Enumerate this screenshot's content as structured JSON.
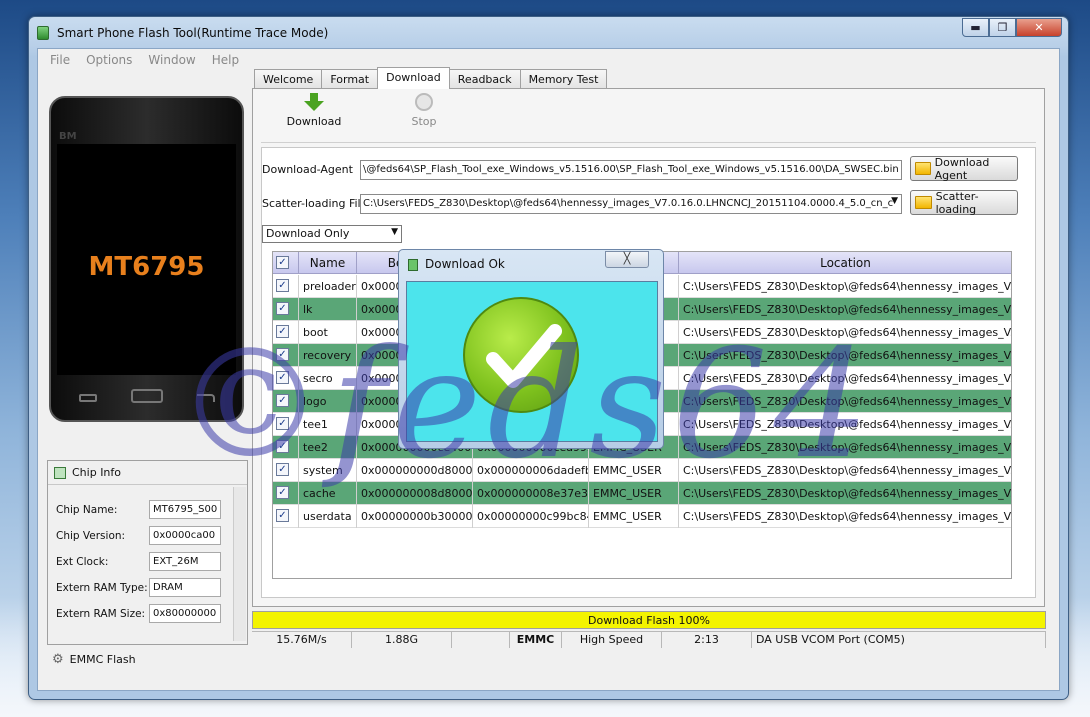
{
  "window": {
    "title": "Smart Phone Flash Tool(Runtime Trace Mode)",
    "min": "▬",
    "max": "❐",
    "close": "✕"
  },
  "menu": [
    "File",
    "Options",
    "Window",
    "Help"
  ],
  "phone": {
    "brand": "BM",
    "chip": "MT6795"
  },
  "chip_info": {
    "title": "Chip Info",
    "rows": [
      {
        "label": "Chip Name:",
        "value": "MT6795_S00"
      },
      {
        "label": "Chip Version:",
        "value": "0x0000ca00"
      },
      {
        "label": "Ext Clock:",
        "value": "EXT_26M"
      },
      {
        "label": "Extern RAM Type:",
        "value": "DRAM"
      },
      {
        "label": "Extern RAM Size:",
        "value": "0x80000000"
      }
    ],
    "footer": "EMMC Flash"
  },
  "tabs": [
    "Welcome",
    "Format",
    "Download",
    "Readback",
    "Memory Test"
  ],
  "active_tab": "Download",
  "toolbar": {
    "download": "Download",
    "stop": "Stop"
  },
  "form": {
    "da_label": "Download-Agent",
    "da_path": "\\@feds64\\SP_Flash_Tool_exe_Windows_v5.1516.00\\SP_Flash_Tool_exe_Windows_v5.1516.00\\DA_SWSEC.bin",
    "da_button": "Download Agent",
    "scatter_label": "Scatter-loading File",
    "scatter_path": "C:\\Users\\FEDS_Z830\\Desktop\\@feds64\\hennessy_images_V7.0.16.0.LHNCNCJ_20151104.0000.4_5.0_cn_c",
    "scatter_button": "Scatter-loading",
    "mode": "Download Only"
  },
  "table": {
    "headers": [
      "✓",
      "Name",
      "Begin Ad",
      "",
      "",
      "Location"
    ],
    "rows": [
      {
        "check": "✓",
        "name": "preloader",
        "begin": "0x0000000",
        "end": "",
        "region": "",
        "location": "C:\\Users\\FEDS_Z830\\Desktop\\@feds64\\hennessy_images_V..."
      },
      {
        "check": "✓",
        "name": "lk",
        "begin": "0x0000000",
        "end": "",
        "region": "",
        "location": "C:\\Users\\FEDS_Z830\\Desktop\\@feds64\\hennessy_images_V..."
      },
      {
        "check": "✓",
        "name": "boot",
        "begin": "0x0000000",
        "end": "",
        "region": "",
        "location": "C:\\Users\\FEDS_Z830\\Desktop\\@feds64\\hennessy_images_V..."
      },
      {
        "check": "✓",
        "name": "recovery",
        "begin": "0x0000000",
        "end": "",
        "region": "",
        "location": "C:\\Users\\FEDS_Z830\\Desktop\\@feds64\\hennessy_images_V..."
      },
      {
        "check": "✓",
        "name": "secro",
        "begin": "0x0000000",
        "end": "",
        "region": "",
        "location": "C:\\Users\\FEDS_Z830\\Desktop\\@feds64\\hennessy_images_V..."
      },
      {
        "check": "✓",
        "name": "logo",
        "begin": "0x0000000",
        "end": "",
        "region": "",
        "location": "C:\\Users\\FEDS_Z830\\Desktop\\@feds64\\hennessy_images_V..."
      },
      {
        "check": "✓",
        "name": "tee1",
        "begin": "0x0000000",
        "end": "",
        "region": "",
        "location": "C:\\Users\\FEDS_Z830\\Desktop\\@feds64\\hennessy_images_V..."
      },
      {
        "check": "✓",
        "name": "tee2",
        "begin": "0x000000000ce40000",
        "end": "0x000000000cea992b",
        "region": "EMMC_USER",
        "location": "C:\\Users\\FEDS_Z830\\Desktop\\@feds64\\hennessy_images_V..."
      },
      {
        "check": "✓",
        "name": "system",
        "begin": "0x000000000d800000",
        "end": "0x000000006dadefbf",
        "region": "EMMC_USER",
        "location": "C:\\Users\\FEDS_Z830\\Desktop\\@feds64\\hennessy_images_V..."
      },
      {
        "check": "✓",
        "name": "cache",
        "begin": "0x000000008d800000",
        "end": "0x000000008e37e3b7",
        "region": "EMMC_USER",
        "location": "C:\\Users\\FEDS_Z830\\Desktop\\@feds64\\hennessy_images_V..."
      },
      {
        "check": "✓",
        "name": "userdata",
        "begin": "0x00000000b3000000",
        "end": "0x00000000c99bc843",
        "region": "EMMC_USER",
        "location": "C:\\Users\\FEDS_Z830\\Desktop\\@feds64\\hennessy_images_V..."
      }
    ]
  },
  "progress": {
    "label": "Download Flash 100%",
    "value": 1.0
  },
  "status": [
    "15.76M/s",
    "1.88G",
    "",
    "EMMC",
    "High Speed",
    "2:13",
    "DA USB VCOM Port (COM5)"
  ],
  "dialog": {
    "title": "Download Ok",
    "close": "╳"
  },
  "watermark": "©feds64",
  "colors": {
    "progress": "#f4f400",
    "row_alt": "#5aa677",
    "dialog_body": "#4ce4ec",
    "check_green": "#7fc21e"
  }
}
